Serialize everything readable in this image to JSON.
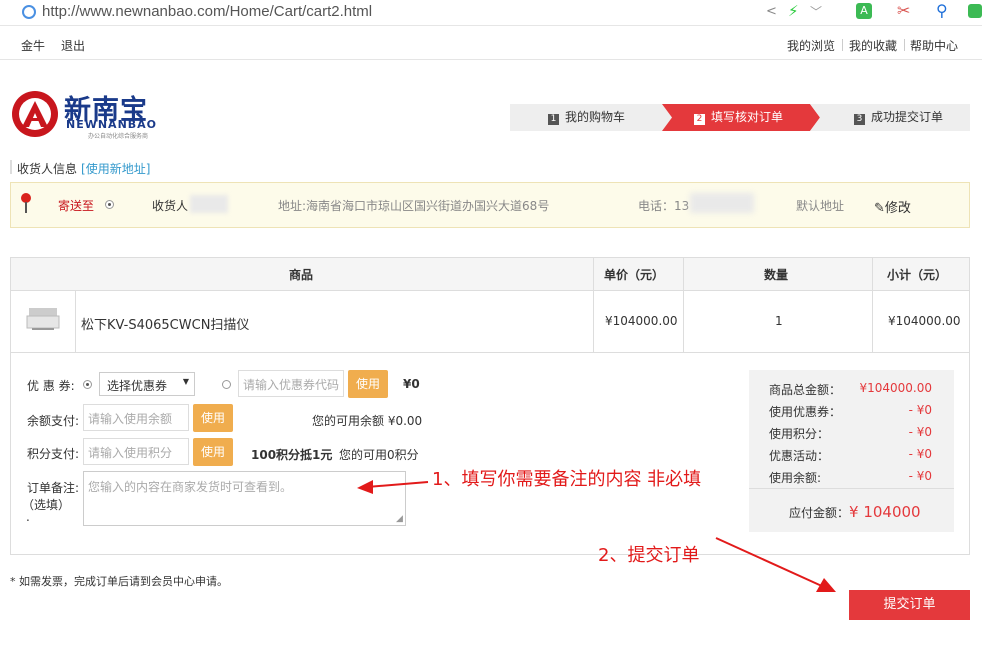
{
  "browser": {
    "url": "http://www.newnanbao.com/Home/Cart/cart2.html"
  },
  "topnav": {
    "left": [
      "金牛",
      "退出"
    ],
    "right": [
      "我的浏览",
      "我的收藏",
      "帮助中心"
    ]
  },
  "logo": {
    "cn": "新南宝",
    "en": "NEWNANBAO",
    "tagline": "办公自动化综合服务商"
  },
  "steps": [
    {
      "num": "1",
      "label": "我的购物车",
      "active": false
    },
    {
      "num": "2",
      "label": "填写核对订单",
      "active": true
    },
    {
      "num": "3",
      "label": "成功提交订单",
      "active": false
    }
  ],
  "receiver": {
    "title": "收货人信息",
    "new_addr": "[使用新地址]",
    "ship_to": "寄送至",
    "name_label": "收货人",
    "address": "地址:海南省海口市琼山区国兴街道办国兴大道68号",
    "phone": "电话：13",
    "default": "默认地址",
    "edit": "修改"
  },
  "table": {
    "headers": [
      "商品",
      "单价（元）",
      "数量",
      "小计（元）"
    ],
    "rows": [
      {
        "name": "松下KV-S4065CWCN扫描仪",
        "price": "¥104000.00",
        "qty": "1",
        "subtotal": "¥104000.00"
      }
    ]
  },
  "coupon": {
    "label": "优 惠 券:",
    "select": "选择优惠券",
    "code_placeholder": "请输入优惠券代码",
    "use": "使用",
    "amount": "¥0"
  },
  "balance": {
    "label": "余额支付:",
    "placeholder": "请输入使用余额",
    "use": "使用",
    "available": "您的可用余额 ¥0.00"
  },
  "points": {
    "label": "积分支付:",
    "placeholder": "请输入使用积分",
    "use": "使用",
    "rate": "100积分抵1元",
    "available": "您的可用0积分"
  },
  "remark": {
    "label1": "订单备注:",
    "label2": "（选填）",
    "dot": ".",
    "placeholder": "您输入的内容在商家发货时可查看到。"
  },
  "summary": {
    "rows": [
      {
        "label": "商品总金额：",
        "value": "¥104000.00"
      },
      {
        "label": "使用优惠券：",
        "value": "- ¥0"
      },
      {
        "label": "使用积分：",
        "value": "- ¥0"
      },
      {
        "label": "优惠活动：",
        "value": "- ¥0"
      },
      {
        "label": "使用余额:",
        "value": "- ¥0"
      }
    ],
    "payable_label": "应付金额：",
    "payable_value": "¥ 104000"
  },
  "invoice_note": "* 如需发票，完成订单后请到会员中心申请。",
  "submit": "提交订单",
  "annotations": {
    "a1": "1、填写你需要备注的内容 非必填",
    "a2": "2、提交订单"
  },
  "colors": {
    "brand_red": "#c8161d",
    "accent_red": "#e4393c",
    "orange": "#f0ad4e",
    "link_blue": "#3399cc"
  }
}
